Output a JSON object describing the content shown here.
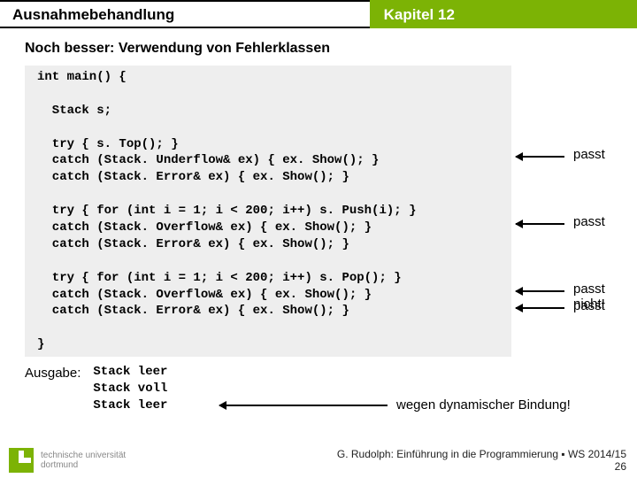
{
  "header": {
    "left": "Ausnahmebehandlung",
    "right": "Kapitel 12"
  },
  "section_title": "Noch besser: Verwendung von Fehlerklassen",
  "code": {
    "l1": "int main() {",
    "l2": "",
    "l3": "  Stack s;",
    "l4": "",
    "l5": "  try { s. Top(); }",
    "l6": "  catch (Stack. Underflow& ex) { ex. Show(); }",
    "l7": "  catch (Stack. Error& ex) { ex. Show(); }",
    "l8": "",
    "l9": "  try { for (int i = 1; i < 200; i++) s. Push(i); }",
    "l10": "  catch (Stack. Overflow& ex) { ex. Show(); }",
    "l11": "  catch (Stack. Error& ex) { ex. Show(); }",
    "l12": "",
    "l13": "  try { for (int i = 1; i < 200; i++) s. Pop(); }",
    "l14": "  catch (Stack. Overflow& ex) { ex. Show(); }",
    "l15": "  catch (Stack. Error& ex) { ex. Show(); }",
    "l16": "",
    "l17": "}"
  },
  "notes": {
    "n1": "passt",
    "n2": "passt",
    "n3": "passt nicht!",
    "n4": "passt"
  },
  "output_label": "Ausgabe:",
  "output": {
    "o1": "Stack leer",
    "o2": "Stack voll",
    "o3": "Stack leer"
  },
  "dynbind": "wegen dynamischer Bindung!",
  "footer": {
    "uni1": "technische universität",
    "uni2": "dortmund",
    "line": "G. Rudolph: Einführung in die Programmierung ▪ WS 2014/15",
    "page": "26"
  }
}
